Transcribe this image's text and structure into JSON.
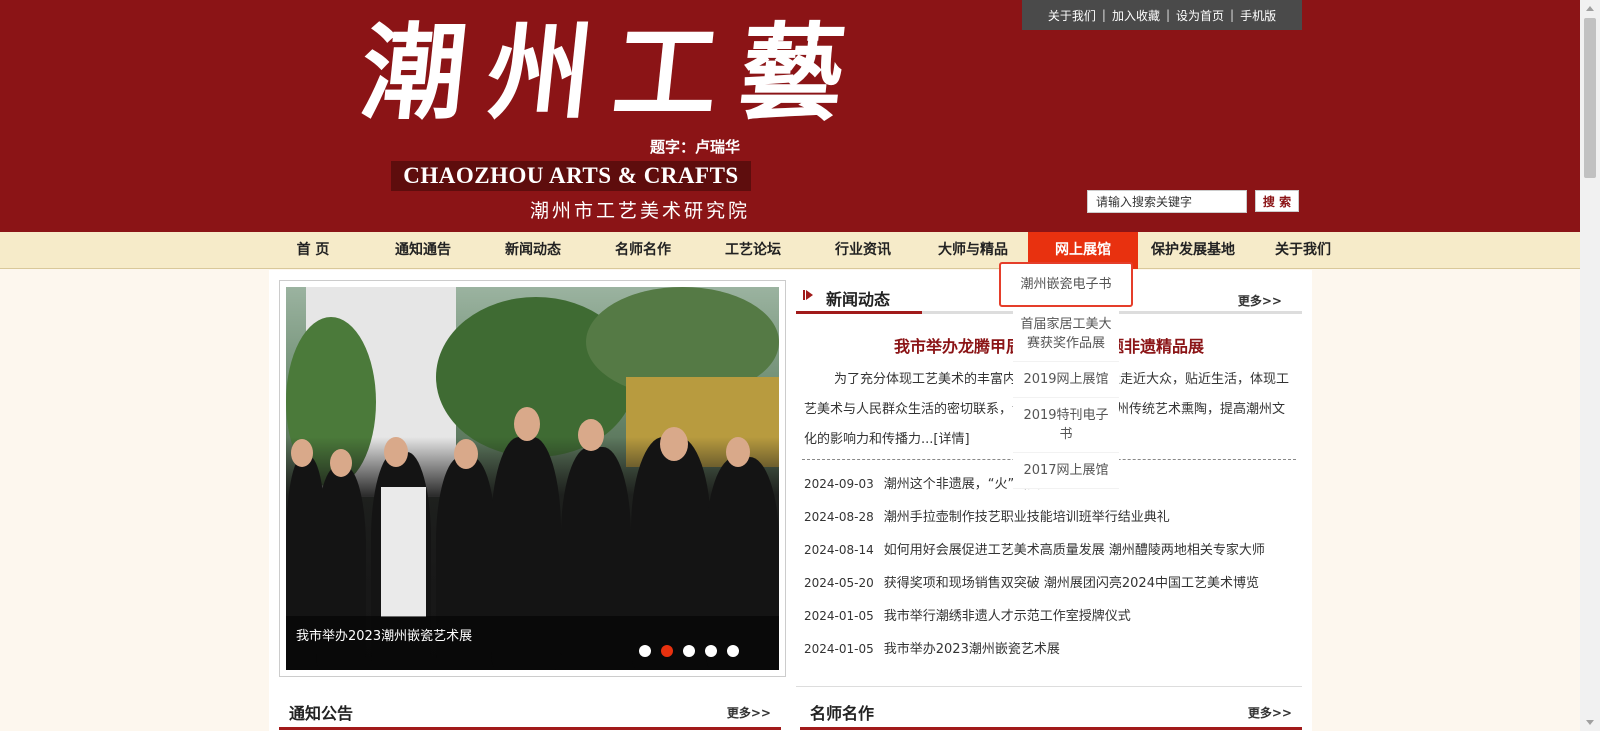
{
  "header": {
    "top_links": [
      "关于我们",
      "加入收藏",
      "设为首页",
      "手机版"
    ],
    "logo_cn": "潮州工藝",
    "logo_credit": "题字：卢瑞华",
    "logo_en": "CHAOZHOU ARTS & CRAFTS",
    "logo_org": "潮州市工艺美术研究院",
    "search_placeholder": "请输入搜索关键字",
    "search_button": "搜 索"
  },
  "nav": {
    "items": [
      "首 页",
      "通知通告",
      "新闻动态",
      "名师名作",
      "工艺论坛",
      "行业资讯",
      "大师与精品",
      "网上展馆",
      "保护发展基地",
      "关于我们"
    ],
    "active": "网上展馆"
  },
  "dropdown": {
    "items": [
      "潮州嵌瓷电子书",
      "首届家居工美大赛获奖作品展",
      "2019网上展馆",
      "2019特刊电子书",
      "2017网上展馆"
    ]
  },
  "slider": {
    "caption": "我市举办2023潮州嵌瓷艺术展",
    "dot_count": 5,
    "active_dot": 2
  },
  "news": {
    "title": "新闻动态",
    "more": "更多>>",
    "headline": "我市举办龙腾甲辰·潮州非遗主题非遗精品展",
    "summary": "为了充分体现工艺美术的丰富内涵，推动潮州非遗走近大众，贴近生活，体现工艺美术与人民群众生活的密切联系，让广大市民感受潮州传统艺术熏陶，提高潮州文化的影响力和传播力...[详情]",
    "items": [
      {
        "date": "2024-09-03",
        "title": "潮州这个非遗展，“火”出圈了"
      },
      {
        "date": "2024-08-28",
        "title": "潮州手拉壶制作技艺职业技能培训班举行结业典礼"
      },
      {
        "date": "2024-08-14",
        "title": "如何用好会展促进工艺美术高质量发展 潮州醴陵两地相关专家大师"
      },
      {
        "date": "2024-05-20",
        "title": "获得奖项和现场销售双突破 潮州展团闪亮2024中国工艺美术博览"
      },
      {
        "date": "2024-01-05",
        "title": "我市举行潮绣非遗人才示范工作室授牌仪式"
      },
      {
        "date": "2024-01-05",
        "title": "我市举办2023潮州嵌瓷艺术展"
      }
    ]
  },
  "notices": {
    "title": "通知公告",
    "more": "更多>>"
  },
  "masters": {
    "title": "名师名作",
    "more": "更多>>"
  },
  "colors": {
    "brand": "#8b1416",
    "accent": "#e8310f",
    "nav_bg": "#f6ebc9"
  }
}
